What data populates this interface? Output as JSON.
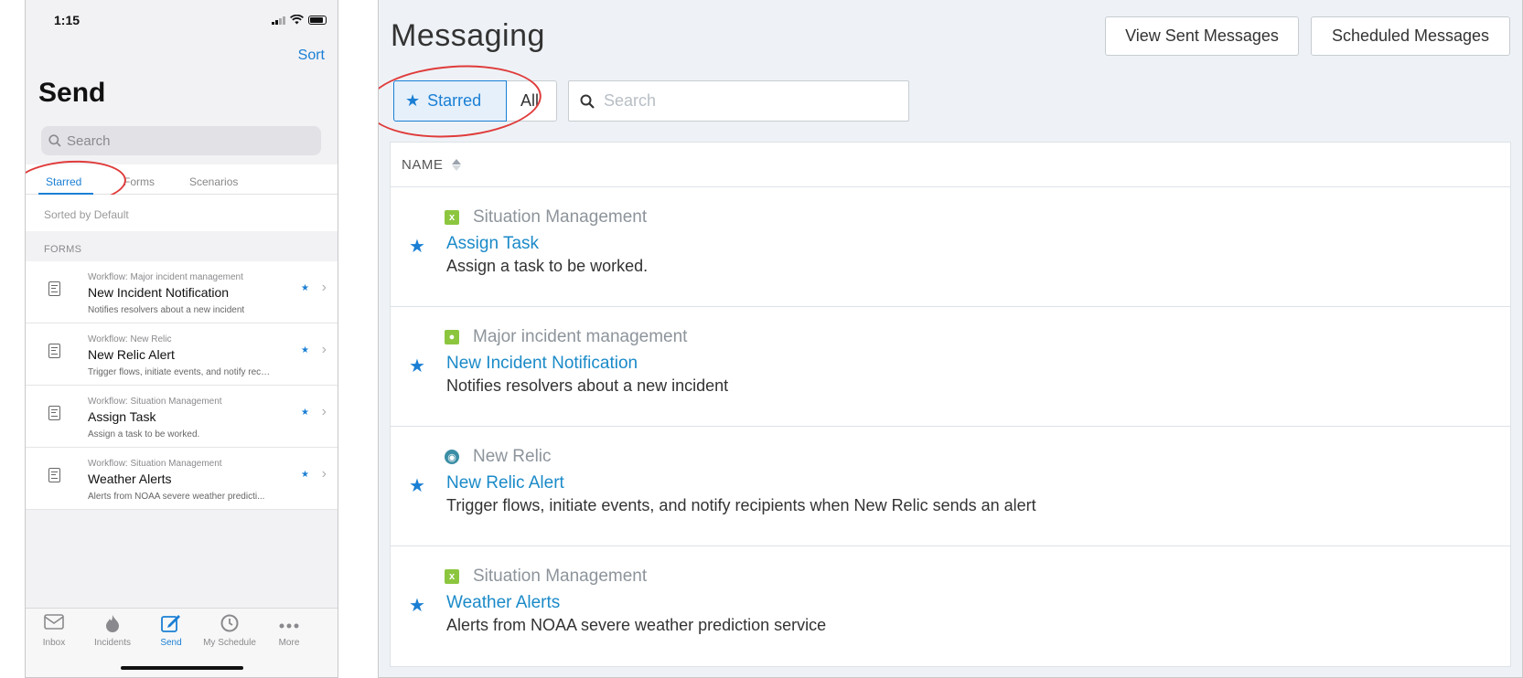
{
  "phone": {
    "status_time": "1:15",
    "sort_label": "Sort",
    "title": "Send",
    "search_placeholder": "Search",
    "tabs": [
      {
        "label": "Starred",
        "active": true
      },
      {
        "label": "Forms",
        "active": false
      },
      {
        "label": "Scenarios",
        "active": false
      }
    ],
    "sorted_by": "Sorted by Default",
    "section_header": "FORMS",
    "items": [
      {
        "workflow": "Workflow: Major incident management",
        "name": "New Incident Notification",
        "description": "Notifies resolvers about a new incident"
      },
      {
        "workflow": "Workflow: New Relic",
        "name": "New Relic Alert",
        "description": "Trigger flows, initiate events, and notify recip..."
      },
      {
        "workflow": "Workflow: Situation Management",
        "name": "Assign Task",
        "description": "Assign a task to be worked."
      },
      {
        "workflow": "Workflow: Situation Management",
        "name": "Weather Alerts",
        "description": "Alerts from NOAA severe weather predicti..."
      }
    ],
    "tabbar": [
      {
        "label": "Inbox",
        "icon": "inbox-icon"
      },
      {
        "label": "Incidents",
        "icon": "flame-icon"
      },
      {
        "label": "Send",
        "icon": "compose-icon",
        "active": true
      },
      {
        "label": "My Schedule",
        "icon": "clock-icon"
      },
      {
        "label": "More",
        "icon": "more-icon"
      }
    ]
  },
  "desktop": {
    "title": "Messaging",
    "view_sent_label": "View Sent Messages",
    "scheduled_label": "Scheduled Messages",
    "filter_starred": "Starred",
    "filter_all": "All",
    "search_placeholder": "Search",
    "column_name": "NAME",
    "rows": [
      {
        "workflow": "Situation Management",
        "badge_color": "#8cc63f",
        "badge_glyph": "x",
        "name": "Assign Task",
        "description": "Assign a task to be worked."
      },
      {
        "workflow": "Major incident management",
        "badge_color": "#8cc63f",
        "badge_glyph": "●",
        "name": "New Incident Notification",
        "description": "Notifies resolvers about a new incident"
      },
      {
        "workflow": "New Relic",
        "badge_color": "#3b8ea5",
        "badge_glyph": "◉",
        "name": "New Relic Alert",
        "description": "Trigger flows, initiate events, and notify recipients when New Relic sends an alert"
      },
      {
        "workflow": "Situation Management",
        "badge_color": "#8cc63f",
        "badge_glyph": "x",
        "name": "Weather Alerts",
        "description": "Alerts from NOAA severe weather prediction service"
      }
    ]
  },
  "colors": {
    "accent": "#1a7fd4",
    "link": "#1a8ac8",
    "annotation": "#e03b3b"
  }
}
